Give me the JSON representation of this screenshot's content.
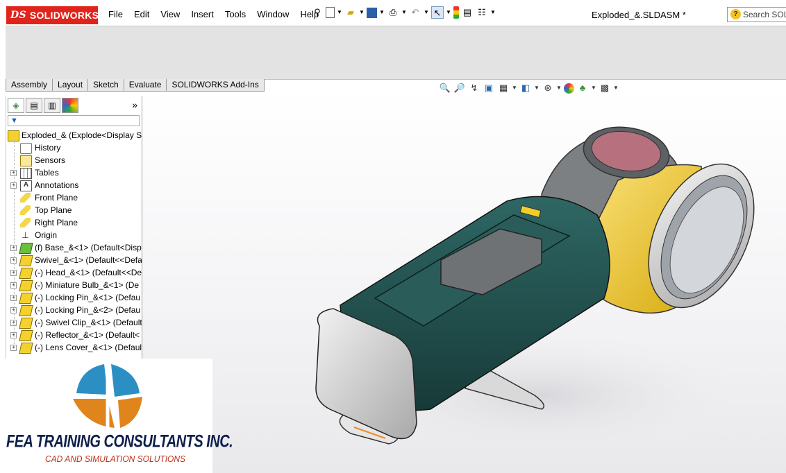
{
  "app": {
    "brand_ds": "DS",
    "brand": "SOLIDWORKS",
    "menu": [
      "File",
      "Edit",
      "View",
      "Insert",
      "Tools",
      "Window",
      "Help"
    ],
    "document_title": "Exploded_&.SLDASM *",
    "search_placeholder": "Search SOL"
  },
  "command_tabs": [
    "Assembly",
    "Layout",
    "Sketch",
    "Evaluate",
    "SOLIDWORKS Add-Ins"
  ],
  "panel": {
    "tabs": [
      "feature-manager",
      "property-manager",
      "configuration-manager",
      "display-manager"
    ],
    "expand_glyph": "»",
    "filter_glyph": "▼"
  },
  "tree": {
    "root": "Exploded_& (Explode<Display St",
    "items": [
      {
        "label": "History",
        "icon": "history-icon",
        "expand": false,
        "kind": "hist"
      },
      {
        "label": "Sensors",
        "icon": "sensors-icon",
        "expand": false,
        "kind": "sens"
      },
      {
        "label": "Tables",
        "icon": "tables-icon",
        "expand": true,
        "kind": "tab"
      },
      {
        "label": "Annotations",
        "icon": "annotations-icon",
        "expand": true,
        "kind": "ann",
        "glyph": "A"
      },
      {
        "label": "Front Plane",
        "icon": "plane-icon",
        "expand": false,
        "kind": "plane"
      },
      {
        "label": "Top Plane",
        "icon": "plane-icon",
        "expand": false,
        "kind": "plane"
      },
      {
        "label": "Right Plane",
        "icon": "plane-icon",
        "expand": false,
        "kind": "plane"
      },
      {
        "label": "Origin",
        "icon": "origin-icon",
        "expand": false,
        "kind": "orig",
        "glyph": "⊥"
      },
      {
        "label": "(f) Base_&<1> (Default<Disp",
        "icon": "part-icon",
        "expand": true,
        "kind": "base"
      },
      {
        "label": "Swivel_&<1> (Default<<Defa",
        "icon": "part-icon",
        "expand": true,
        "kind": "part"
      },
      {
        "label": "(-) Head_&<1> (Default<<De",
        "icon": "part-icon",
        "expand": true,
        "kind": "part"
      },
      {
        "label": "(-) Miniature Bulb_&<1> (De",
        "icon": "part-icon",
        "expand": true,
        "kind": "part"
      },
      {
        "label": "(-) Locking Pin_&<1> (Defau",
        "icon": "part-icon",
        "expand": true,
        "kind": "part"
      },
      {
        "label": "(-) Locking Pin_&<2> (Defau",
        "icon": "part-icon",
        "expand": true,
        "kind": "part"
      },
      {
        "label": "(-) Swivel Clip_&<1> (Default",
        "icon": "part-icon",
        "expand": true,
        "kind": "part"
      },
      {
        "label": "(-) Reflector_&<1> (Default<",
        "icon": "part-icon",
        "expand": true,
        "kind": "part"
      },
      {
        "label": "(-) Lens Cover_&<1> (Defaul",
        "icon": "part-icon",
        "expand": true,
        "kind": "part"
      }
    ]
  },
  "watermark": {
    "name": "FEA TRAINING  CONSULTANTS INC.",
    "tagline": "CAD AND SIMULATION SOLUTIONS"
  },
  "colors": {
    "brand_red": "#e0231b",
    "housing_teal": "#1f4f4c",
    "swivel_yellow": "#f2cc2a",
    "lens_pink": "#b7707e",
    "gray_metal": "#8a8a8a",
    "logo_blue": "#2b8fc4",
    "logo_orange": "#e0841c"
  }
}
